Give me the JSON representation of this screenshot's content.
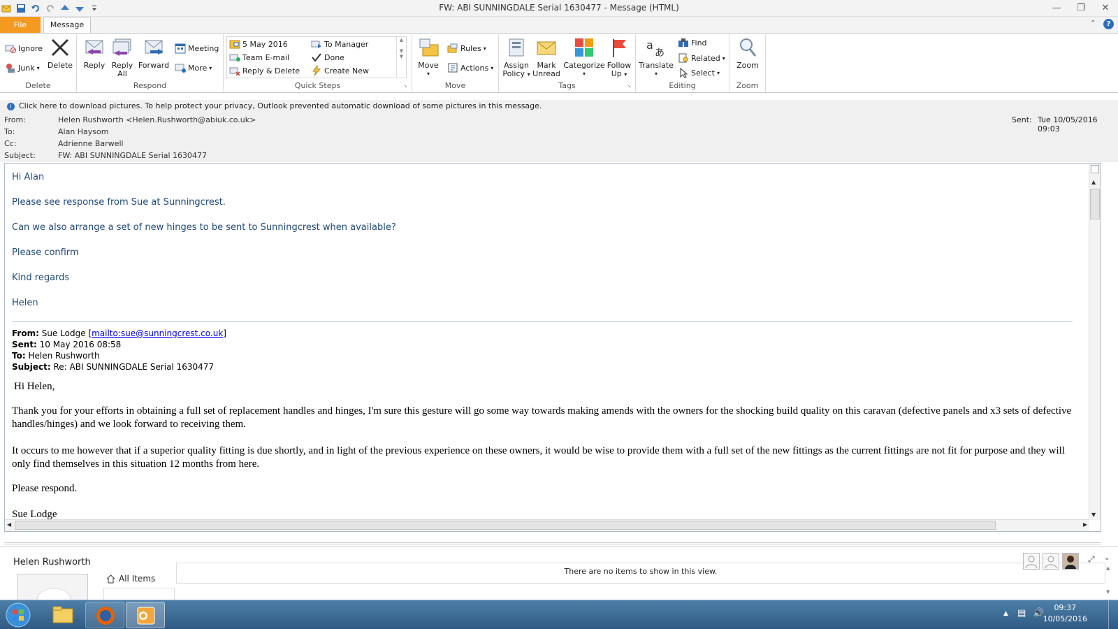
{
  "window": {
    "title": "FW: ABI SUNNINGDALE Serial 1630477  -  Message (HTML)"
  },
  "tabs": {
    "file": "File",
    "message": "Message"
  },
  "ribbon": {
    "delete_group": {
      "label": "Delete",
      "ignore": "Ignore",
      "junk": "Junk",
      "delete": "Delete"
    },
    "respond_group": {
      "label": "Respond",
      "reply": "Reply",
      "reply_all_1": "Reply",
      "reply_all_2": "All",
      "forward": "Forward",
      "meeting": "Meeting",
      "more": "More"
    },
    "quicksteps_group": {
      "label": "Quick Steps",
      "items": [
        "5 May 2016",
        "To Manager",
        "Team E-mail",
        "Done",
        "Reply & Delete",
        "Create New"
      ]
    },
    "move_group": {
      "label": "Move",
      "move": "Move",
      "rules": "Rules",
      "actions": "Actions"
    },
    "tags_group": {
      "label": "Tags",
      "assign_1": "Assign",
      "assign_2": "Policy",
      "mark_1": "Mark",
      "mark_2": "Unread",
      "categorize": "Categorize",
      "follow_1": "Follow",
      "follow_2": "Up"
    },
    "editing_group": {
      "label": "Editing",
      "translate": "Translate",
      "find": "Find",
      "related": "Related",
      "select": "Select"
    },
    "zoom_group": {
      "label": "Zoom",
      "zoom": "Zoom"
    }
  },
  "infobar": {
    "text": "Click here to download pictures. To help protect your privacy, Outlook prevented automatic download of some pictures in this message."
  },
  "header": {
    "from_label": "From:",
    "from_value": "Helen Rushworth <Helen.Rushworth@abiuk.co.uk>",
    "to_label": "To:",
    "to_value": "Alan Haysom",
    "cc_label": "Cc:",
    "cc_value": "Adrienne Barwell",
    "subject_label": "Subject:",
    "subject_value": "FW: ABI SUNNINGDALE Serial 1630477",
    "sent_label": "Sent:",
    "sent_value": "Tue 10/05/2016 09:03"
  },
  "body": {
    "lines": [
      "Hi Alan",
      "Please see response from Sue at Sunningcrest.",
      "Can we also arrange a set of new hinges to be sent to Sunningcrest when available?",
      "Please confirm",
      "Kind regards",
      "Helen"
    ],
    "quote": {
      "from_label": "From:",
      "from_name": " Sue Lodge [",
      "from_link": "mailto:sue@sunningcrest.co.uk",
      "from_end": "]",
      "sent_label": "Sent:",
      "sent_value": " 10 May 2016 08:58",
      "to_label": "To:",
      "to_value": " Helen Rushworth",
      "subject_label": "Subject:",
      "subject_value": " Re: ABI SUNNINGDALE Serial 1630477"
    },
    "reply": {
      "greeting": "Hi Helen,",
      "para1": "Thank you for your efforts in obtaining a full set of replacement handles and hinges, I'm sure this gesture will go some way towards making amends with the owners for the shocking build quality on this caravan (defective panels and x3 sets of defective handles/hinges) and we look forward to receiving them.",
      "para2": "It occurs to me however that if a superior quality fitting is due shortly, and in light of the previous experience on these owners, it would be wise to provide them with a full set of the new fittings as the current fittings are not fit for purpose and they will only find themselves in this situation 12 months from here.",
      "para3": "Please respond.",
      "signature": "Sue Lodge"
    }
  },
  "people_pane": {
    "name": "Helen Rushworth",
    "all_items": "All Items",
    "empty_text": "There are no items to show in this view."
  },
  "taskbar": {
    "time": "09:37",
    "date": "10/05/2016"
  }
}
